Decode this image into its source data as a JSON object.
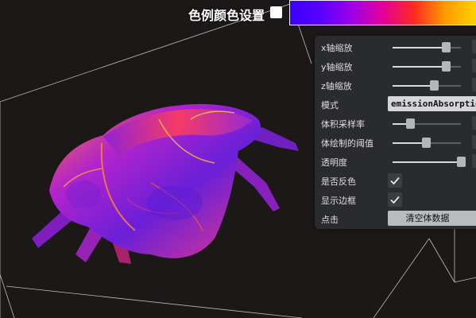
{
  "colormap": {
    "label": "色例颜色设置",
    "checked": false,
    "gradient_stops": [
      "#3a00ff",
      "#5800ff",
      "#9e00e8",
      "#e4009a",
      "#ff2a20",
      "#ff9a00",
      "#ffd000"
    ]
  },
  "panel": {
    "controls": [
      {
        "type": "slider",
        "label": "x轴缩放",
        "value": 0.78
      },
      {
        "type": "slider",
        "label": "y轴缩放",
        "value": 0.78
      },
      {
        "type": "slider",
        "label": "z轴缩放",
        "value": 0.6
      },
      {
        "type": "select",
        "label": "模式",
        "value": "emissionAbsorption"
      },
      {
        "type": "slider",
        "label": "体积采样率",
        "value": 0.26
      },
      {
        "type": "slider",
        "label": "体绘制的阈值",
        "value": 0.49
      },
      {
        "type": "slider",
        "label": "透明度",
        "value": 1.0
      },
      {
        "type": "checkbox",
        "label": "是否反色",
        "checked": true
      },
      {
        "type": "checkbox",
        "label": "显示边框",
        "checked": true
      },
      {
        "type": "button",
        "label": "点击",
        "button_label": "清空体数据"
      }
    ]
  },
  "scene": {
    "background": "#1c1817",
    "bounding_box_color": "#c8c8c8",
    "volume_colors": [
      "#6b1fd6",
      "#a11fd0",
      "#ff2a5a",
      "#ff8a1a",
      "#ffd23a"
    ]
  }
}
